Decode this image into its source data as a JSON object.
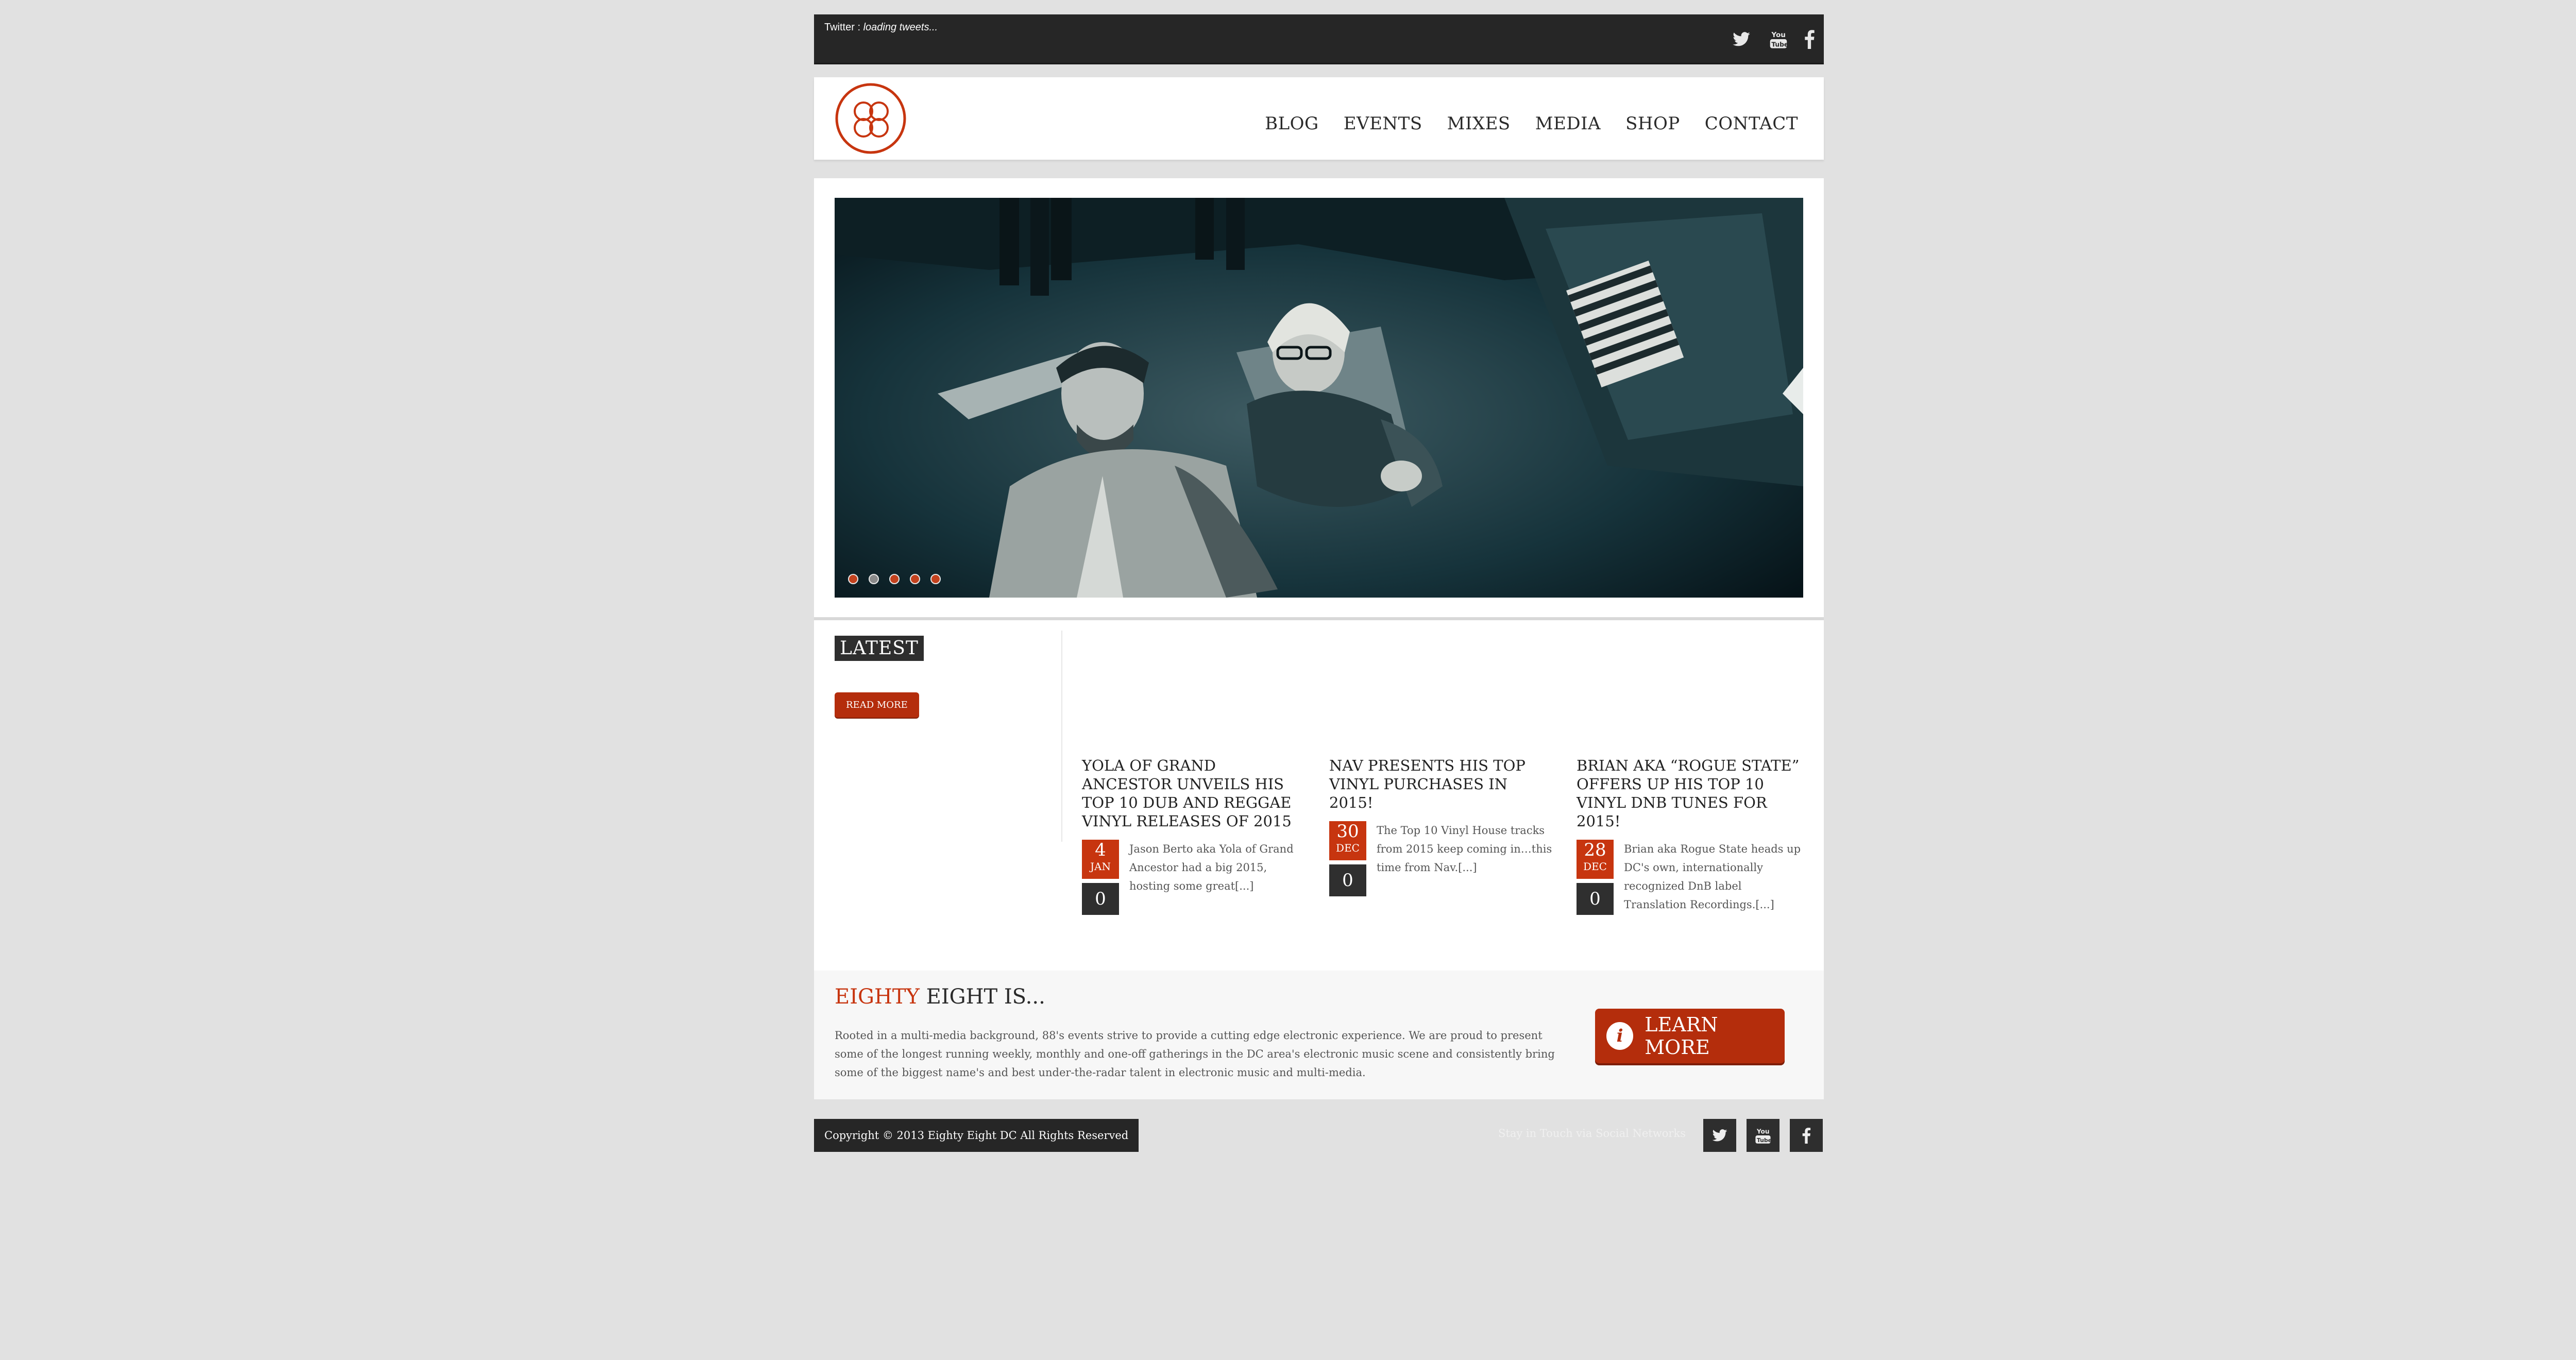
{
  "topbar": {
    "twitter_prefix": "Twitter : ",
    "twitter_status": "loading tweets..."
  },
  "header": {
    "logo_text": "88",
    "nav": [
      "BLOG",
      "EVENTS",
      "MIXES",
      "MEDIA",
      "SHOP",
      "CONTACT"
    ]
  },
  "slider": {
    "dot_count": 5,
    "active_dot": 1
  },
  "latest": {
    "title": "LATEST",
    "read_more": "READ MORE",
    "posts": [
      {
        "title": "YOLA OF GRAND ANCESTOR UNVEILS HIS TOP 10 DUB AND REGGAE VINYL RELEASES OF 2015",
        "day": "4",
        "month": "JAN",
        "comments": "0",
        "excerpt": "Jason Berto aka Yola of Grand Ancestor had a big 2015, hosting some great[...]"
      },
      {
        "title": "NAV PRESENTS HIS TOP VINYL PURCHASES IN 2015!",
        "day": "30",
        "month": "DEC",
        "comments": "0",
        "excerpt": "The Top 10 Vinyl House tracks from 2015 keep coming in…this time from Nav.[...]"
      },
      {
        "title": "BRIAN AKA “ROGUE STATE” OFFERS UP HIS TOP 10 VINYL DNB TUNES FOR 2015!",
        "day": "28",
        "month": "DEC",
        "comments": "0",
        "excerpt": "Brian aka Rogue State heads up DC's own, internationally recognized DnB label Translation Recordings.[...]"
      }
    ]
  },
  "about": {
    "title_highlight": "EIGHTY",
    "title_rest": " EIGHT IS...",
    "body": "Rooted in a multi-media background, 88's events strive to provide a cutting edge electronic experience. We are proud to present some of the longest running weekly, monthly and one-off gatherings in the DC area's electronic music scene and consistently bring some of the biggest name's and best under-the-radar talent in electronic music and multi-media.",
    "learn_more": "LEARN MORE",
    "info_icon_glyph": "i"
  },
  "footer": {
    "copyright": "Copyright © 2013 Eighty Eight DC All Rights Reserved",
    "stay_in_touch": "Stay in Touch via Social Networks"
  },
  "colors": {
    "accent": "#c7350f",
    "button": "#b42d0c",
    "dark": "#262626",
    "background": "#e1e1e1"
  },
  "icons": [
    "twitter-icon",
    "youtube-icon",
    "facebook-icon",
    "info-icon"
  ]
}
